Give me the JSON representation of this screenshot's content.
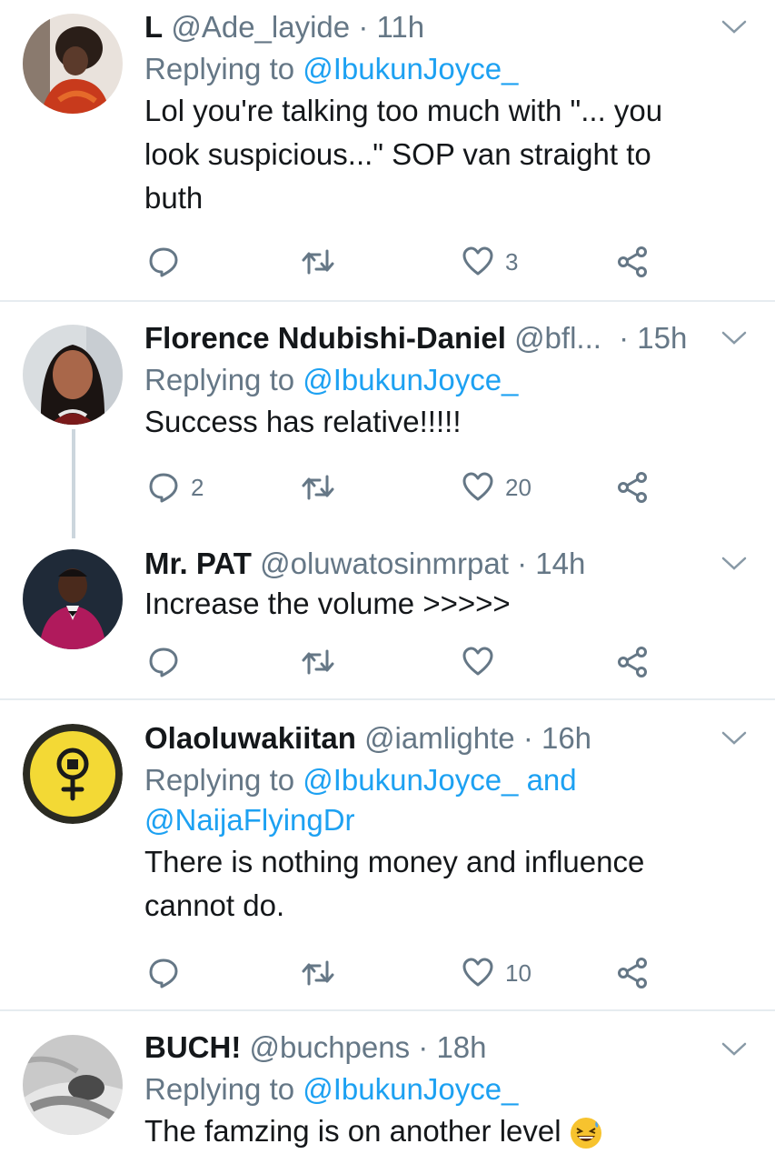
{
  "tweets": [
    {
      "name": "L",
      "handle": "@Ade_layide",
      "time": "· 11h",
      "replying_prefix": "Replying to ",
      "replying_to": "@IbukunJoyce_",
      "text_lines": [
        "Lol you're talking too much with \"... you",
        "look suspicious...\" SOP van straight to",
        "buth"
      ],
      "counts": {
        "reply": "",
        "retweet": "",
        "like": "3"
      }
    },
    {
      "name": "Florence Ndubishi-Daniel",
      "handle": "@bfl...",
      "time": "· 15h",
      "replying_prefix": "Replying to ",
      "replying_to": "@IbukunJoyce_",
      "text_lines": [
        "Success has relative!!!!!"
      ],
      "counts": {
        "reply": "2",
        "retweet": "",
        "like": "20"
      }
    },
    {
      "name": "Mr. PAT",
      "handle": "@oluwatosinmrpat",
      "time": "· 14h",
      "text_lines": [
        "Increase the volume >>>>>"
      ],
      "counts": {
        "reply": "",
        "retweet": "",
        "like": ""
      }
    },
    {
      "name": "Olaoluwakiitan",
      "handle": "@iamlighte",
      "time": "· 16h",
      "replying_prefix": "Replying to ",
      "replying_to": "@IbukunJoyce_",
      "replying_and": " and",
      "replying_to_2": "@NaijaFlyingDr",
      "text_lines": [
        "There is nothing money and influence",
        "cannot do."
      ],
      "counts": {
        "reply": "",
        "retweet": "",
        "like": "10"
      }
    },
    {
      "name": "BUCH!",
      "handle": "@buchpens",
      "time": "· 18h",
      "replying_prefix": "Replying to ",
      "replying_to": "@IbukunJoyce_",
      "text_lines": [
        "The famzing is on another level"
      ],
      "emoji": "grinning-squinting-face-with-sweat"
    }
  ],
  "icons": {
    "reply": "speech-bubble-icon",
    "retweet": "retweet-icon",
    "like": "heart-icon",
    "share": "share-icon",
    "menu": "chevron-down-icon"
  },
  "colors": {
    "link": "#1da1f2",
    "secondary_text": "#657786",
    "divider": "#e6ecf0",
    "thread_line": "#ccd6dd"
  }
}
